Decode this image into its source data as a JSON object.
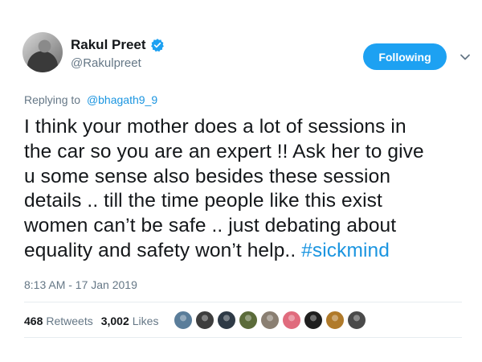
{
  "author": {
    "display_name": "Rakul Preet",
    "handle": "@Rakulpreet",
    "verified": true
  },
  "follow_button": {
    "label": "Following"
  },
  "reply": {
    "prefix": "Replying to",
    "mention": "@bhagath9_9"
  },
  "tweet": {
    "line1": "I think your mother does a lot of sessions in",
    "line2": "the car so you are an expert !! Ask her to give",
    "line3": "u some sense also besides these session",
    "line4": "details .. till the time people like this exist",
    "line5": "women can’t be safe .. just debating about",
    "line6": "equality and safety won’t help.. ",
    "hashtag": "#sickmind"
  },
  "timestamp": "8:13 AM - 17 Jan 2019",
  "stats": {
    "retweets_count": "468",
    "retweets_label": "Retweets",
    "likes_count": "3,002",
    "likes_label": "Likes"
  },
  "liker_avatar_colors": [
    "#5a7d9a",
    "#3d3d3d",
    "#2e3a46",
    "#5b6b3a",
    "#8a7f72",
    "#e06b7d",
    "#1f1f1f",
    "#b07a2a",
    "#4a4a4a"
  ],
  "colors": {
    "accent": "#1da1f2",
    "link": "#1b95e0",
    "secondary_text": "#657786"
  }
}
